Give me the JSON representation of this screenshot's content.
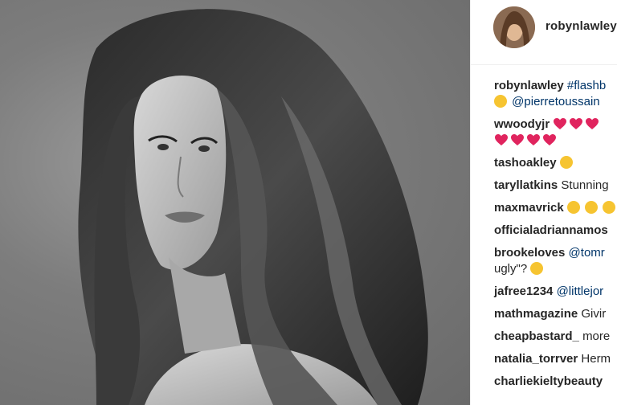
{
  "post": {
    "image_alt_icon": "portrait-photo",
    "username": "robynlawley"
  },
  "comments": [
    {
      "user": "robynlawley",
      "text": "#flashb",
      "line2_mention": "@pierretoussain",
      "line2_emoji": "kissing-face"
    },
    {
      "user": "wwoodyjr",
      "hearts_line1": 3,
      "hearts_line2": 4
    },
    {
      "user": "tashoakley",
      "emoji": "heart-eyes-face"
    },
    {
      "user": "taryllatkins",
      "text": "Stunning"
    },
    {
      "user": "maxmavrick",
      "emoji": "confounded-face, grimacing-face"
    },
    {
      "user": "officialadriannamos"
    },
    {
      "user": "brookeloves",
      "mention": "@tomr",
      "line2": "ugly\"?",
      "line2_emoji": "smiling-face"
    },
    {
      "user": "jafree1234",
      "mention": "@littlejor"
    },
    {
      "user": "mathmagazine",
      "text": "Givir"
    },
    {
      "user": "cheapbastard_",
      "text": "more"
    },
    {
      "user": "natalia_torrver",
      "text": "Herm"
    },
    {
      "user": "charliekieltybeauty"
    }
  ],
  "colors": {
    "mention": "#003569",
    "text": "#262626",
    "border": "#efefef"
  }
}
